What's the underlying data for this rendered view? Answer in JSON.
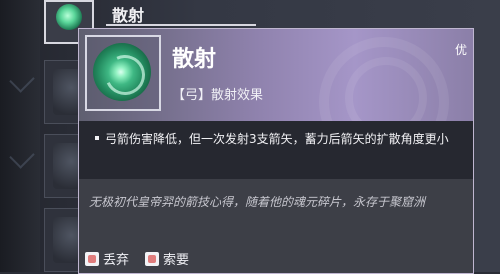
{
  "inventory": {
    "selected_slot_label": "散射"
  },
  "tooltip": {
    "title": "散射",
    "subtitle": "【弓】散射效果",
    "rarity": "优",
    "description": "弓箭伤害降低，但一次发射3支箭矢，蓄力后箭矢的扩散角度更小",
    "lore": "无极初代皇帝羿的箭技心得，随着他的魂元碎片，永存于聚窟洲",
    "actions": [
      {
        "label": "丢弃"
      },
      {
        "label": "索要"
      }
    ]
  },
  "colors": {
    "header_gradient_mid": "#8f82ad",
    "item_green": "#3fb884",
    "card_bg": "#3d3f47",
    "desc_bg": "#262830"
  },
  "icons": {
    "item": "green-swirl-icon",
    "discard": "discard-icon",
    "request": "request-icon"
  }
}
